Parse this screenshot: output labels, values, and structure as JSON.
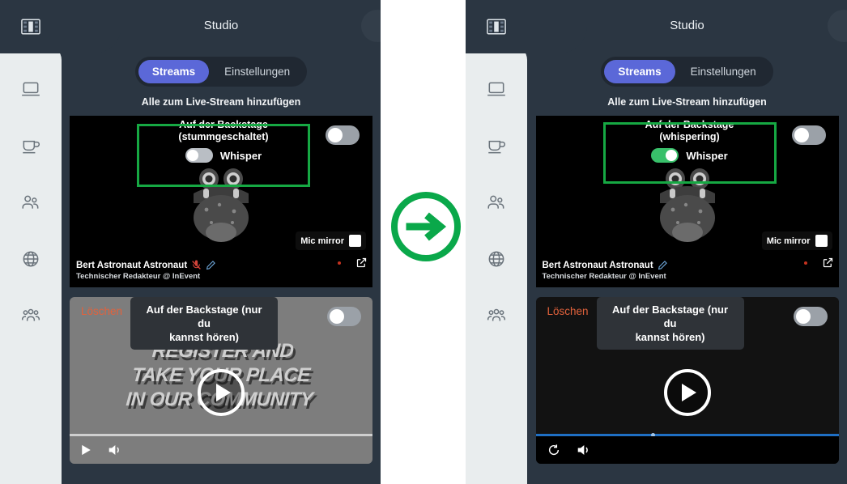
{
  "colors": {
    "accent_green": "#16a843",
    "tab_active": "#5b68d8",
    "panel_bg": "#2b3642",
    "rail_bg": "#e9edee",
    "delete_red": "#e2623c",
    "toggle_on": "#38c06a",
    "progress_blue": "#1f6fc4"
  },
  "panels": [
    {
      "id": "before",
      "header": {
        "title": "Studio"
      },
      "sidebar": {
        "logo_icon": "film-strip-icon",
        "items": [
          {
            "icon": "laptop-icon",
            "name": "sidebar-item-laptop"
          },
          {
            "icon": "coffee-cup-icon",
            "name": "sidebar-item-lounge"
          },
          {
            "icon": "two-people-icon",
            "name": "sidebar-item-people"
          },
          {
            "icon": "globe-icon",
            "name": "sidebar-item-globe"
          },
          {
            "icon": "group-people-icon",
            "name": "sidebar-item-group"
          }
        ]
      },
      "tabs": [
        {
          "label": "Streams",
          "active": true
        },
        {
          "label": "Einstellungen",
          "active": false
        }
      ],
      "subtitle": "Alle zum Live-Stream hinzufügen",
      "participant": {
        "status_line_1": "Auf der Backstage",
        "status_line_2": "(stummgeschaltet)",
        "whisper_label": "Whisper",
        "whisper_on": false,
        "stream_toggle_on": false,
        "mic_mirror_label": "Mic mirror",
        "mic_mirror_checked": false,
        "name": "Bert Astronaut Astronaut",
        "role": "Technischer Redakteur @ InEvent",
        "icons": [
          "mic-muted-icon",
          "pencil-edit-icon"
        ],
        "avatar_icon": "monster-avatar"
      },
      "video": {
        "delete_label": "Löschen",
        "label_line_1": "Auf der Backstage (nur du",
        "label_line_2": "kannst hören)",
        "toggle_on": false,
        "poster_line_1": "REGISTER AND",
        "poster_line_2": "TAKE YOUR PLACE",
        "poster_line_3": "IN OUR COMMUNITY",
        "poster_visible": true,
        "controls": [
          "play-icon",
          "volume-icon"
        ],
        "progress_style": "light"
      }
    },
    {
      "id": "after",
      "header": {
        "title": "Studio"
      },
      "sidebar": {
        "logo_icon": "film-strip-icon",
        "items": [
          {
            "icon": "laptop-icon",
            "name": "sidebar-item-laptop"
          },
          {
            "icon": "coffee-cup-icon",
            "name": "sidebar-item-lounge"
          },
          {
            "icon": "two-people-icon",
            "name": "sidebar-item-people"
          },
          {
            "icon": "globe-icon",
            "name": "sidebar-item-globe"
          },
          {
            "icon": "group-people-icon",
            "name": "sidebar-item-group"
          }
        ]
      },
      "tabs": [
        {
          "label": "Streams",
          "active": true
        },
        {
          "label": "Einstellungen",
          "active": false
        }
      ],
      "subtitle": "Alle zum Live-Stream hinzufügen",
      "participant": {
        "status_line_1": "Auf der Backstage",
        "status_line_2": "(whispering)",
        "whisper_label": "Whisper",
        "whisper_on": true,
        "stream_toggle_on": false,
        "mic_mirror_label": "Mic mirror",
        "mic_mirror_checked": false,
        "name": "Bert Astronaut Astronaut",
        "role": "Technischer Redakteur @ InEvent",
        "icons": [
          "pencil-edit-icon"
        ],
        "avatar_icon": "monster-avatar"
      },
      "video": {
        "delete_label": "Löschen",
        "label_line_1": "Auf der Backstage (nur du",
        "label_line_2": "kannst hören)",
        "toggle_on": false,
        "poster_line_1": "",
        "poster_line_2": "",
        "poster_line_3": "",
        "poster_visible": false,
        "controls": [
          "replay-icon",
          "volume-icon"
        ],
        "progress_style": "blue"
      }
    }
  ],
  "transition": {
    "icon": "arrow-right-circle-icon"
  }
}
